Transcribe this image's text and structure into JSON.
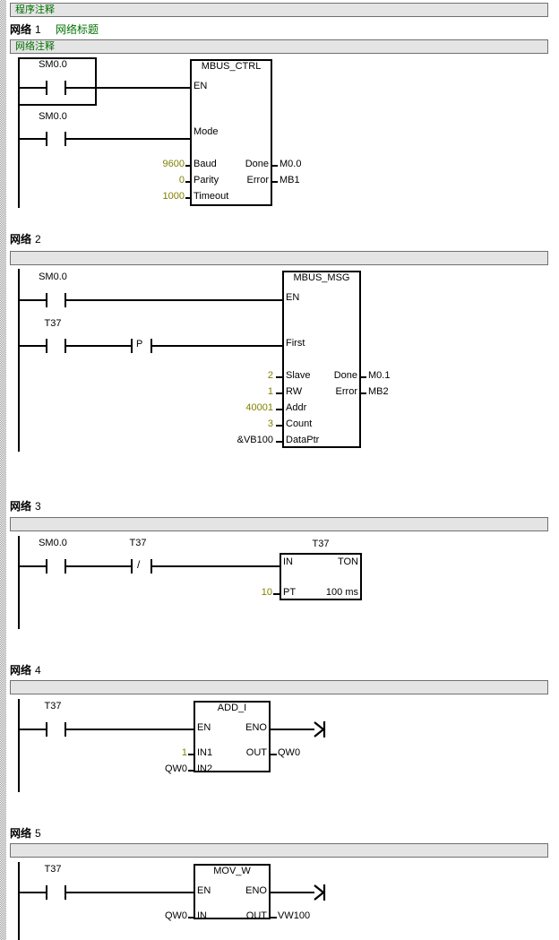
{
  "editor": {
    "program_comment": "程序注释",
    "network_label_prefix": "网络",
    "network_title": "网络标题",
    "network_comment": "网络注释",
    "colors": {
      "comment_text": "#007000",
      "constant_text": "#808000",
      "bar_fill": "#e4e4e4",
      "bar_border": "#707070",
      "wire": "#000000"
    }
  },
  "networks": [
    {
      "number": "1",
      "title": "网络标题",
      "comment": "网络注释",
      "rungs": [
        {
          "contacts": [
            {
              "label": "SM0.0",
              "type": "no",
              "selected": true
            }
          ]
        },
        {
          "contacts": [
            {
              "label": "SM0.0",
              "type": "no",
              "selected": false
            }
          ]
        }
      ],
      "block": {
        "name": "MBUS_CTRL",
        "inputs": [
          {
            "pin": "EN",
            "operand": ""
          },
          {
            "pin": "Mode",
            "operand": ""
          },
          {
            "pin": "Baud",
            "operand": "9600",
            "is_constant": true
          },
          {
            "pin": "Parity",
            "operand": "0",
            "is_constant": true
          },
          {
            "pin": "Timeout",
            "operand": "1000",
            "is_constant": true
          }
        ],
        "outputs": [
          {
            "pin": "Done",
            "operand": "M0.0"
          },
          {
            "pin": "Error",
            "operand": "MB1"
          }
        ]
      }
    },
    {
      "number": "2",
      "title": "",
      "comment": "",
      "rungs": [
        {
          "contacts": [
            {
              "label": "SM0.0",
              "type": "no",
              "selected": false
            }
          ]
        },
        {
          "contacts": [
            {
              "label": "T37",
              "type": "no",
              "selected": false
            },
            {
              "label": "",
              "type": "positive-transition",
              "symbol": "P",
              "selected": false
            }
          ]
        }
      ],
      "block": {
        "name": "MBUS_MSG",
        "inputs": [
          {
            "pin": "EN",
            "operand": ""
          },
          {
            "pin": "First",
            "operand": ""
          },
          {
            "pin": "Slave",
            "operand": "2",
            "is_constant": true
          },
          {
            "pin": "RW",
            "operand": "1",
            "is_constant": true
          },
          {
            "pin": "Addr",
            "operand": "40001",
            "is_constant": true
          },
          {
            "pin": "Count",
            "operand": "3",
            "is_constant": true
          },
          {
            "pin": "DataPtr",
            "operand": "&VB100",
            "is_constant": false
          }
        ],
        "outputs": [
          {
            "pin": "Done",
            "operand": "M0.1"
          },
          {
            "pin": "Error",
            "operand": "MB2"
          }
        ]
      }
    },
    {
      "number": "3",
      "title": "",
      "comment": "",
      "rungs": [
        {
          "contacts": [
            {
              "label": "SM0.0",
              "type": "no",
              "selected": false
            },
            {
              "label": "T37",
              "type": "nc",
              "symbol": "/",
              "selected": false
            }
          ]
        }
      ],
      "block": {
        "name": "T37",
        "kind": "TON",
        "inputs": [
          {
            "pin": "IN",
            "operand": ""
          },
          {
            "pin": "PT",
            "operand": "10",
            "is_constant": true
          }
        ],
        "outputs": [
          {
            "pin": "TON",
            "operand": ""
          },
          {
            "pin": "100 ms",
            "operand": ""
          }
        ]
      }
    },
    {
      "number": "4",
      "title": "",
      "comment": "",
      "rungs": [
        {
          "contacts": [
            {
              "label": "T37",
              "type": "no",
              "selected": false
            }
          ]
        }
      ],
      "block": {
        "name": "ADD_I",
        "inputs": [
          {
            "pin": "EN",
            "operand": ""
          },
          {
            "pin": "IN1",
            "operand": "1",
            "is_constant": true
          },
          {
            "pin": "IN2",
            "operand": "QW0",
            "is_constant": false
          }
        ],
        "outputs": [
          {
            "pin": "ENO",
            "operand": ""
          },
          {
            "pin": "OUT",
            "operand": "QW0"
          }
        ]
      }
    },
    {
      "number": "5",
      "title": "",
      "comment": "",
      "rungs": [
        {
          "contacts": [
            {
              "label": "T37",
              "type": "no",
              "selected": false
            }
          ]
        }
      ],
      "block": {
        "name": "MOV_W",
        "inputs": [
          {
            "pin": "EN",
            "operand": ""
          },
          {
            "pin": "IN",
            "operand": "QW0",
            "is_constant": false
          }
        ],
        "outputs": [
          {
            "pin": "ENO",
            "operand": ""
          },
          {
            "pin": "OUT",
            "operand": "VW100"
          }
        ]
      }
    }
  ]
}
